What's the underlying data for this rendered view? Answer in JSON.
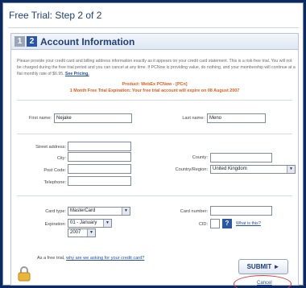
{
  "window": {
    "title": "Free Trial: Step 2 of 2"
  },
  "header": {
    "step1": "1",
    "step2": "2",
    "title": "Account Information"
  },
  "intro": {
    "text": "Please provide your credit card and billing address information exactly as it appears on your credit card statement. This is a risk-free trial. You will not be charged during the free trial period and you can cancel at any time. If PCNow is providing value, do nothing, and your membership will continue at a flat monthly rate of $6.95.",
    "link": "See Pricing."
  },
  "product": {
    "line1": "Product: WebEx PCNow - [PCn]",
    "line2": "1 Month Free Trial Expiration: Your free trial account will expire on 08 August 2007"
  },
  "name": {
    "first_label": "First name:",
    "first_value": "Nejake",
    "last_label": "Last name:",
    "last_value": "Meno"
  },
  "address": {
    "street_label": "Street address:",
    "city_label": "City:",
    "county_label": "County:",
    "postcode_label": "Post Code:",
    "country_label": "Country/Region:",
    "country_value": "United Kingdom",
    "telephone_label": "Telephone:"
  },
  "card": {
    "type_label": "Card type:",
    "type_value": "MasterCard",
    "number_label": "Card number:",
    "expiration_label": "Expiration:",
    "month_value": "01 - January",
    "year_value": "2007",
    "cid_label": "CID:",
    "help_icon": "question-icon",
    "whats_this": "What is this?"
  },
  "footer": {
    "free_trial_text": "As a free trial,",
    "free_trial_link": "why are we asking for your credit card?",
    "submit_label": "SUBMIT ►",
    "cancel_label": "Cancel",
    "lock_icon": "lock-icon"
  },
  "colors": {
    "accent": "#1f3f7a",
    "link": "#1f4fa8",
    "highlight": "#e05b1a",
    "annotation": "#d93a3a"
  }
}
